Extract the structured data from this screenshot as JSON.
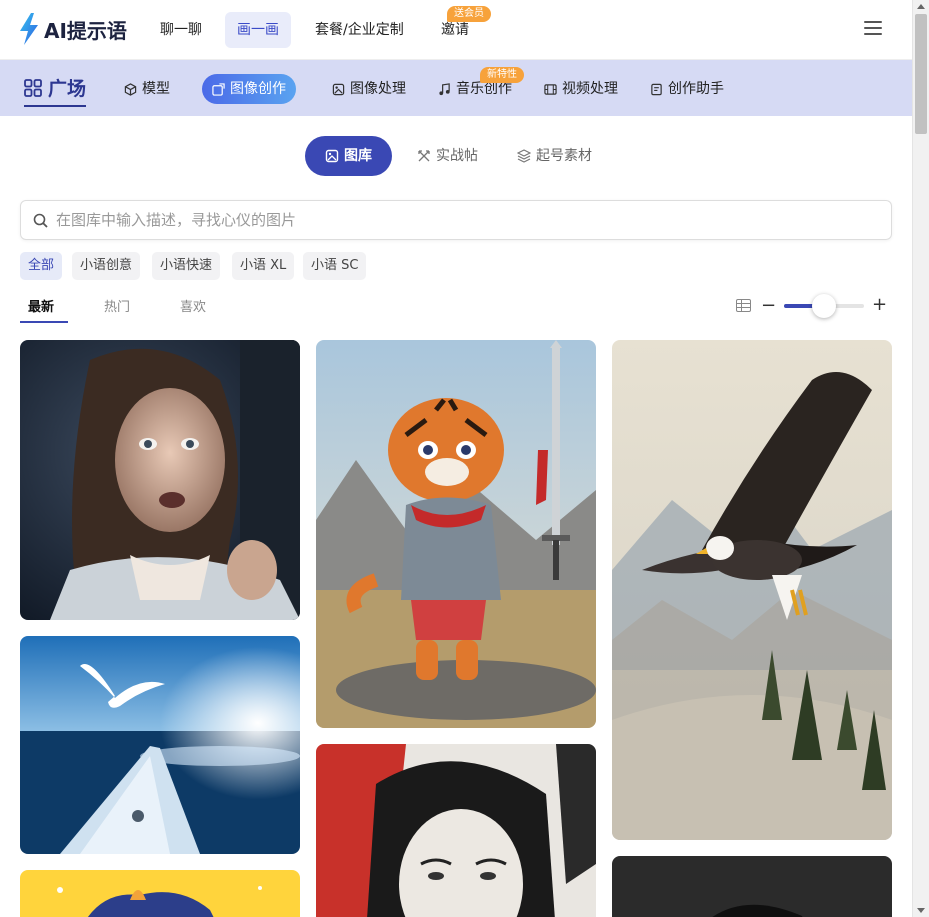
{
  "brand": {
    "name": "AI提示语"
  },
  "top_nav": {
    "items": [
      {
        "label": "聊一聊"
      },
      {
        "label": "画一画"
      },
      {
        "label": "套餐/企业定制"
      },
      {
        "label": "邀请",
        "badge": "送会员"
      }
    ]
  },
  "category_bar": {
    "plaza_label": "广场",
    "items": [
      {
        "label": "模型"
      },
      {
        "label": "图像创作"
      },
      {
        "label": "图像处理"
      },
      {
        "label": "音乐创作",
        "badge": "新特性"
      },
      {
        "label": "视频处理"
      },
      {
        "label": "创作助手"
      }
    ]
  },
  "sub_tabs": [
    {
      "label": "图库"
    },
    {
      "label": "实战帖"
    },
    {
      "label": "起号素材"
    }
  ],
  "search": {
    "placeholder": "在图库中输入描述，寻找心仪的图片",
    "value": ""
  },
  "filters": [
    "全部",
    "小语创意",
    "小语快速",
    "小语 XL",
    "小语 SC"
  ],
  "sort_tabs": [
    "最新",
    "热门",
    "喜欢"
  ],
  "zoom": {
    "level": 0.5
  },
  "colors": {
    "accent": "#3a48b4",
    "badge": "#f7a23b",
    "category_bg": "#d6daf4"
  },
  "gallery": [
    {
      "subject": "frightened girl"
    },
    {
      "subject": "tiger warrior"
    },
    {
      "subject": "bald eagle"
    },
    {
      "subject": "white dove over sea"
    },
    {
      "subject": "ink portrait"
    },
    {
      "subject": "colorful cartoon"
    },
    {
      "subject": "dark portrait"
    }
  ]
}
